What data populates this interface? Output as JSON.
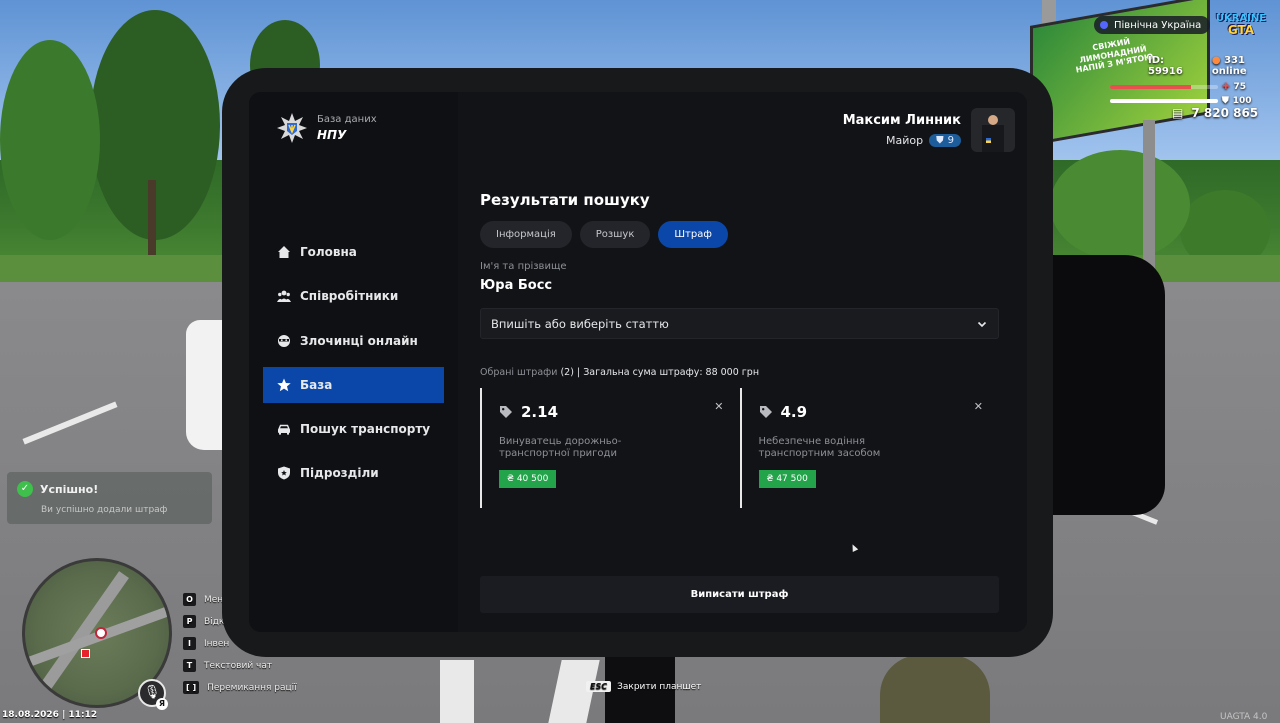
{
  "hud": {
    "server": "Північна Україна",
    "logo_line1": "UKRAINE",
    "logo_line2": "GTA",
    "player_id": "ID: 59916",
    "online": "331 online",
    "health": "75",
    "health_fraction": 0.75,
    "armor": "100",
    "armor_fraction": 1.0,
    "money": "7 820 865",
    "datetime": "18.08.2026 | 11:12",
    "version": "UAGTA 4.0",
    "billboard_text": "СВІЖИЙ ЛИМОНАДНИЙ НАПІЙ З М'ЯТОЮ"
  },
  "notification": {
    "title": "Успішно!",
    "message": "Ви успішно додали штраф"
  },
  "keybinds": [
    {
      "key": "O",
      "label": "Мен"
    },
    {
      "key": "P",
      "label": "Відк"
    },
    {
      "key": "I",
      "label": "Інвен"
    },
    {
      "key": "T",
      "label": "Текстовий чат"
    },
    {
      "key": "[ ]",
      "label": "Перемикання рації"
    }
  ],
  "mic_key": "Я",
  "esc_hint": {
    "key": "ESC",
    "label": "Закрити планшет"
  },
  "tablet": {
    "brand_sub": "База даних",
    "brand_title": "НПУ",
    "nav": [
      {
        "label": "Головна",
        "icon": "home-icon",
        "active": false
      },
      {
        "label": "Співробітники",
        "icon": "users-icon",
        "active": false
      },
      {
        "label": "Злочинці онлайн",
        "icon": "criminal-icon",
        "active": false
      },
      {
        "label": "База",
        "icon": "star-icon",
        "active": true
      },
      {
        "label": "Пошук транспорту",
        "icon": "car-icon",
        "active": false
      },
      {
        "label": "Підрозділи",
        "icon": "shield-icon",
        "active": false
      }
    ],
    "user": {
      "name": "Максим Линник",
      "rank": "Майор",
      "rank_level": "9"
    },
    "section_title": "Результати пошуку",
    "tabs": [
      {
        "label": "Інформація",
        "active": false
      },
      {
        "label": "Розшук",
        "active": false
      },
      {
        "label": "Штраф",
        "active": true
      }
    ],
    "name_label": "Ім'я та прізвище",
    "name_value": "Юра Босс",
    "article_placeholder": "Впишіть або виберіть статтю",
    "selected_prefix": "Обрані штрафи",
    "selected_count": "(2)",
    "selected_total": "| Загальна сума штрафу: 88 000 грн",
    "fines": [
      {
        "code": "2.14",
        "description": "Винуватець дорожньо-транспортної пригоди",
        "price": "₴ 40 500"
      },
      {
        "code": "4.9",
        "description": "Небезпечне водіння транспортним засобом",
        "price": "₴ 47 500"
      }
    ],
    "submit_label": "Виписати штраф"
  },
  "colors": {
    "accent": "#0b47a8",
    "price": "#23a44a",
    "success": "#3fbf4c",
    "health": "#e8504f",
    "armor": "#ffffff"
  }
}
